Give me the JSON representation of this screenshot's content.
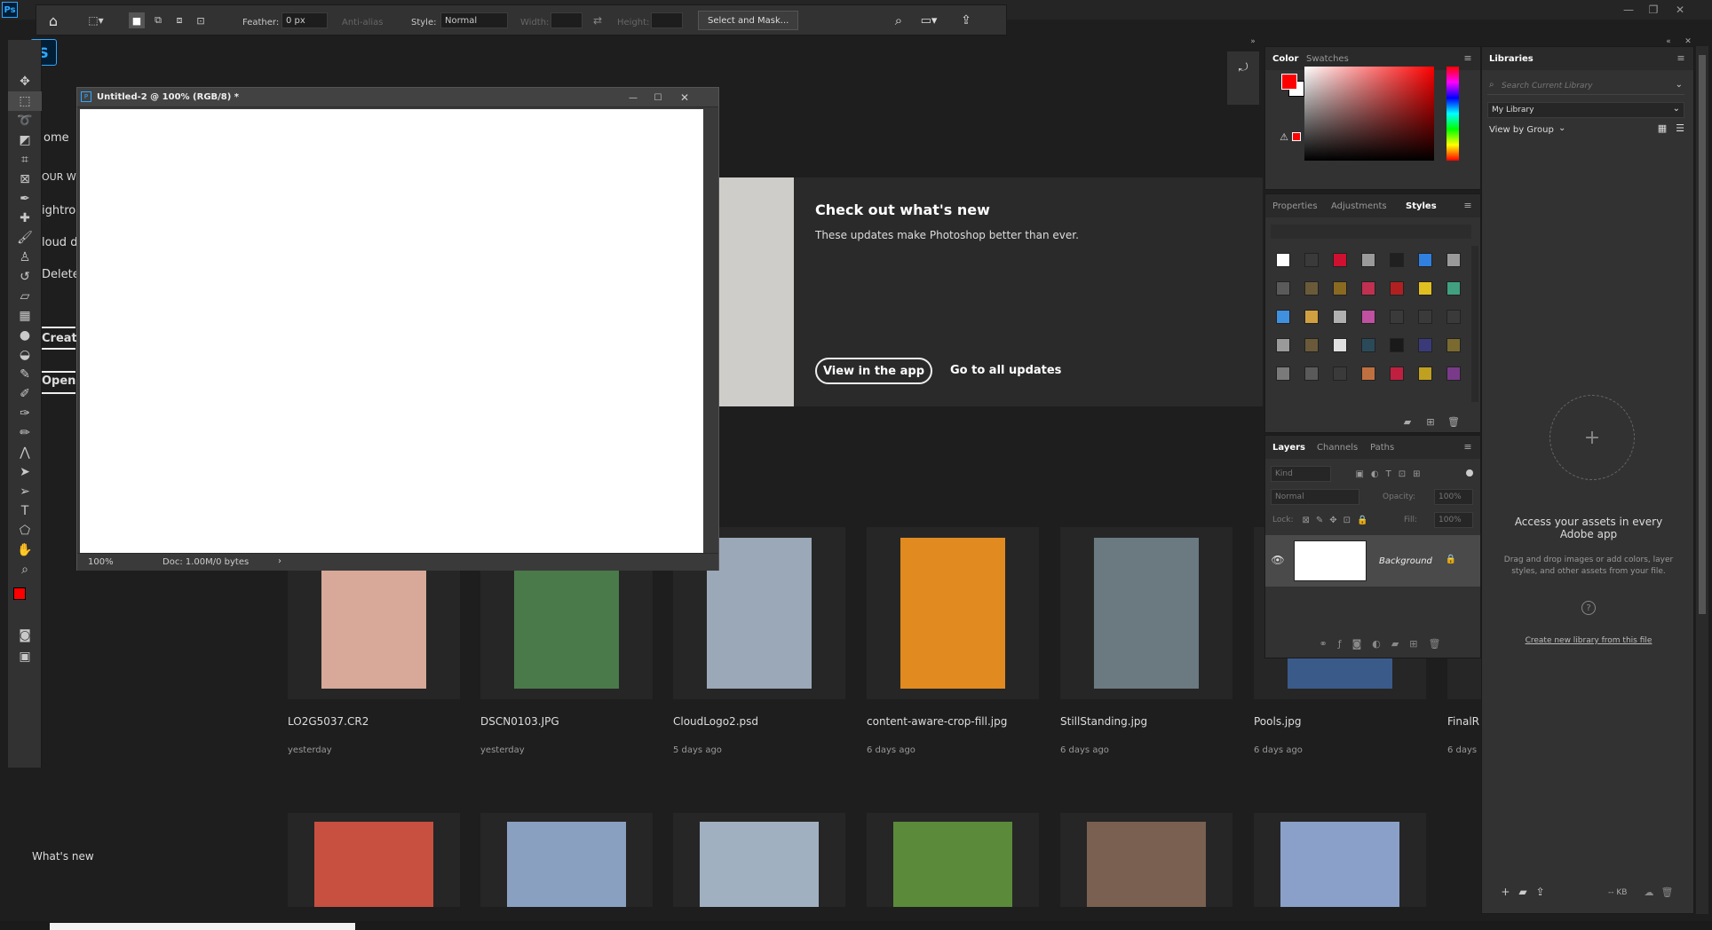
{
  "window": {
    "app_icon": "Ps",
    "min": "—",
    "restore": "❐",
    "close": "✕"
  },
  "options": {
    "feather_label": "Feather:",
    "feather_value": "0 px",
    "antialias_label": "Anti-alias",
    "style_label": "Style:",
    "style_value": "Normal",
    "width_label": "Width:",
    "height_label": "Height:",
    "select_mask": "Select and Mask..."
  },
  "home": {
    "nav": [
      "ome",
      "OUR W",
      "ightroo",
      "loud d",
      "Delete",
      "Create",
      "Open"
    ],
    "whats_new_title": "Check out what's new",
    "whats_new_sub": "These updates make Photoshop better than ever.",
    "view_in_app": "View in the app",
    "go_to_updates": "Go to all updates",
    "whats_new_footer": "What's new",
    "files": [
      {
        "name": "LO2G5037.CR2",
        "date": "yesterday",
        "color": "#d8a898"
      },
      {
        "name": "DSCN0103.JPG",
        "date": "yesterday",
        "color": "#4a7a4a"
      },
      {
        "name": "CloudLogo2.psd",
        "date": "5 days ago",
        "color": "#9aa8b8"
      },
      {
        "name": "content-aware-crop-fill.jpg",
        "date": "6 days ago",
        "color": "#e08a20"
      },
      {
        "name": "StillStanding.jpg",
        "date": "6 days ago",
        "color": "#6a7a80"
      },
      {
        "name": "Pools.jpg",
        "date": "6 days ago",
        "color": "#3a5a8a"
      },
      {
        "name": "FinalR",
        "date": "6 days",
        "color": "#333"
      }
    ],
    "row2_colors": [
      "#c85040",
      "#8aa0c0",
      "#a0b0c0",
      "#5a8a3a",
      "#7a6050",
      "#8aa0c8"
    ]
  },
  "document": {
    "title": "Untitled-2 @ 100% (RGB/8) *",
    "zoom": "100%",
    "doc_info": "Doc: 1.00M/0 bytes"
  },
  "color_panel": {
    "tabs": [
      "Color",
      "Swatches"
    ],
    "fg": "#ff0000",
    "bg": "#ffffff"
  },
  "styles_panel": {
    "tabs": [
      "Properties",
      "Adjustments",
      "Styles"
    ],
    "swatches": [
      "#ffffff",
      "#3a3a3a",
      "#d01030",
      "#9a9a9a",
      "#202020",
      "#3080e0",
      "#9a9a9a",
      "#5a5a5a",
      "#6a5a3a",
      "#8a6a20",
      "#c03050",
      "#b02020",
      "#e0c020",
      "#40a080",
      "#4090e0",
      "#d0a040",
      "#b0b0b0",
      "#c050a0",
      "#3a3a3a",
      "#3a3a3a",
      "#3a3a3a",
      "#9a9a9a",
      "#6a5a3a",
      "#e0e0e0",
      "#2a4a5a",
      "#1a1a1a",
      "#3a3a7a",
      "#7a6a30",
      "#7a7a7a",
      "#5a5a5a",
      "#3a3a3a",
      "#c07040",
      "#c02040",
      "#c0a020",
      "#7a3a8a"
    ]
  },
  "layers_panel": {
    "tabs": [
      "Layers",
      "Channels",
      "Paths"
    ],
    "kind": "Kind",
    "blend": "Normal",
    "opacity_label": "Opacity:",
    "opacity": "100%",
    "lock_label": "Lock:",
    "fill_label": "Fill:",
    "fill": "100%",
    "layer_name": "Background"
  },
  "libraries_panel": {
    "tab": "Libraries",
    "search_placeholder": "Search Current Library",
    "library": "My Library",
    "view_by": "View by Group",
    "access_title": "Access your assets in every Adobe app",
    "access_body": "Drag and drop images or add colors, layer styles, and other assets from your file.",
    "create_link": "Create new library from this file",
    "kb": "-- KB"
  }
}
